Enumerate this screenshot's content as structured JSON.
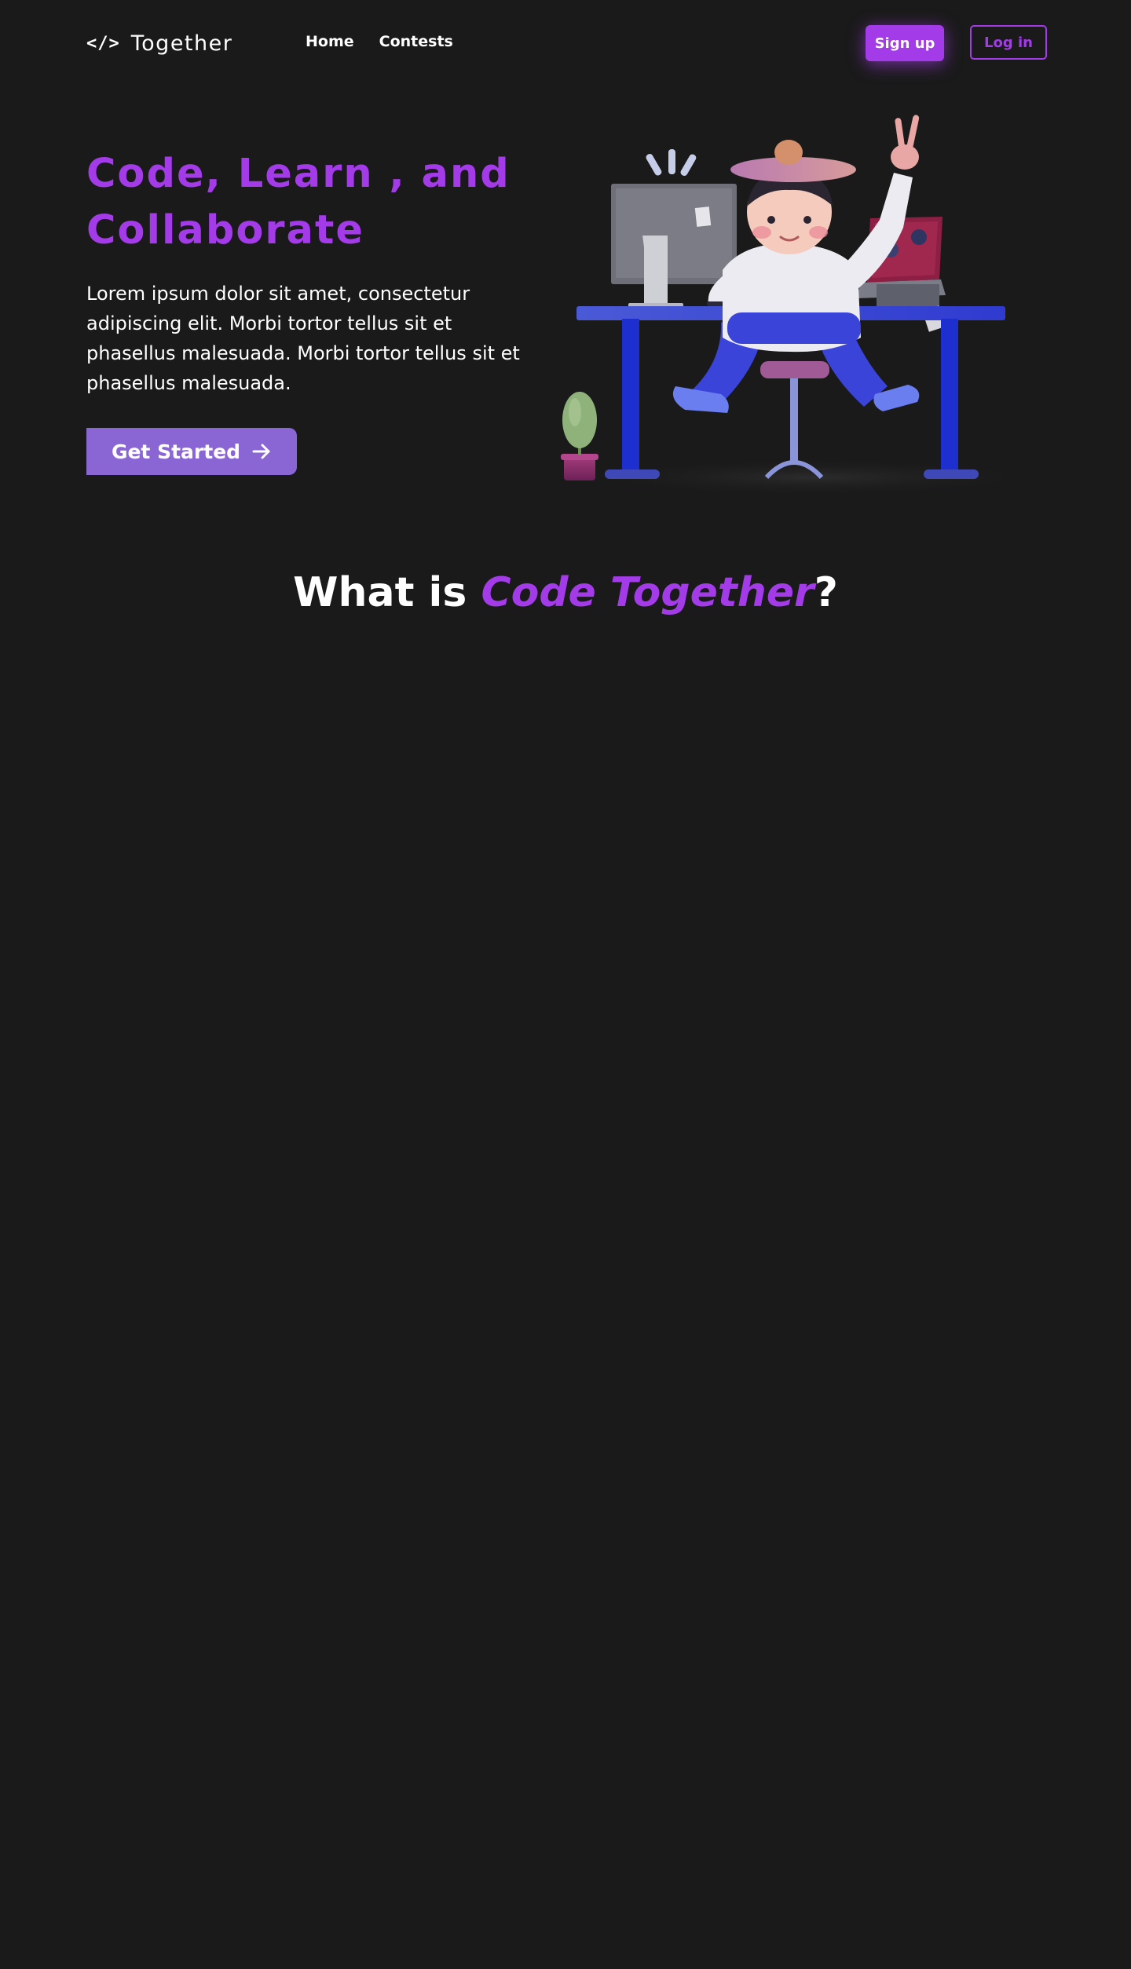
{
  "brand": {
    "mark": "</>",
    "name": "Together"
  },
  "nav": {
    "items": [
      {
        "label": "Home"
      },
      {
        "label": "Contests"
      }
    ],
    "signup_label": "Sign up",
    "login_label": "Log in"
  },
  "hero": {
    "title": "Code, Learn , and Collaborate",
    "description": "Lorem ipsum dolor sit amet, consectetur adipiscing elit. Morbi tortor tellus sit et phasellus malesuada. Morbi tortor tellus sit et phasellus malesuada.",
    "cta_label": "Get Started",
    "cta_icon": "arrow-right-icon",
    "illustration": "developer-at-desk-illustration"
  },
  "about": {
    "title_prefix": "What is ",
    "title_highlight": "Code Together",
    "title_suffix": "?"
  },
  "colors": {
    "background": "#1a1a1a",
    "accent": "#a43be9",
    "cta": "#8a66d4",
    "text": "#ffffff"
  }
}
